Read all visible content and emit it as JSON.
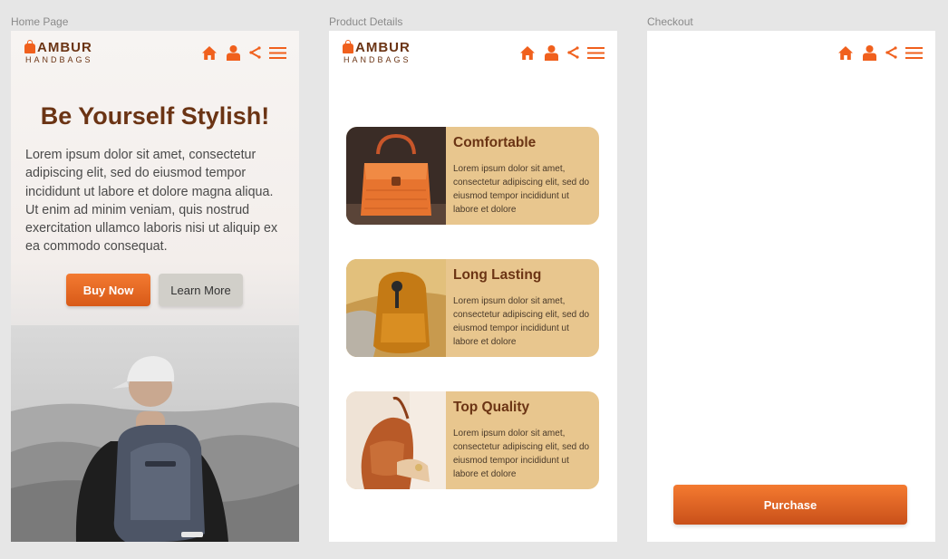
{
  "frames": {
    "home_label": "Home Page",
    "product_label": "Product Details",
    "checkout_label": "Checkout"
  },
  "brand": {
    "name": "AMBUR",
    "tagline": "HANDBAGS"
  },
  "nav_icons": [
    "home-icon",
    "user-icon",
    "share-icon",
    "menu-icon"
  ],
  "home": {
    "title": "Be Yourself Stylish!",
    "body": "Lorem ipsum dolor sit amet, consectetur adipiscing elit, sed do eiusmod tempor incididunt ut labore et dolore magna aliqua. Ut enim ad minim veniam, quis nostrud exercitation ullamco laboris nisi ut aliquip ex ea commodo consequat.",
    "buy_label": "Buy Now",
    "learn_label": "Learn More"
  },
  "product": {
    "cards": [
      {
        "title": "Comfortable",
        "text": "Lorem ipsum dolor sit amet, consectetur adipiscing elit, sed do eiusmod tempor incididunt ut labore et dolore"
      },
      {
        "title": "Long Lasting",
        "text": "Lorem ipsum dolor sit amet, consectetur adipiscing elit, sed do eiusmod tempor incididunt ut labore et dolore"
      },
      {
        "title": "Top Quality",
        "text": "Lorem ipsum dolor sit amet, consectetur adipiscing elit, sed do eiusmod tempor incididunt ut labore et dolore"
      }
    ]
  },
  "checkout": {
    "purchase_label": "Purchase"
  },
  "colors": {
    "accent": "#f0601d",
    "brand_brown": "#6b3414",
    "card_bg": "#e8c68e",
    "canvas": "#e6e6e6"
  }
}
